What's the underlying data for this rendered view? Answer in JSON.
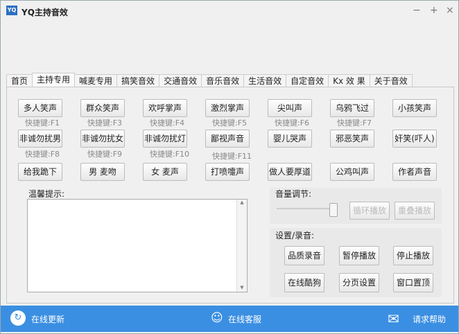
{
  "window": {
    "title": "YQ主持音效",
    "logo": "YQ",
    "minimize": "−",
    "maximize": "+",
    "close": "×"
  },
  "tabs": [
    "首页",
    "主持专用",
    "喊麦专用",
    "搞笑音效",
    "交通音效",
    "音乐音效",
    "生活音效",
    "自定音效",
    "Kx 效 果",
    "关于音效"
  ],
  "active_tab": 1,
  "buttons": [
    [
      "多人笑声",
      "群众笑声",
      "欢呼掌声",
      "激烈掌声",
      "尖叫声",
      "乌鸦飞过",
      "小孩笑声"
    ],
    [
      "非诚勿扰男",
      "非诚勿扰女",
      "非诚勿扰灯",
      "鄙视声音",
      "婴儿哭声",
      "邪恶笑声",
      "奸笑(吓人)"
    ],
    [
      "给我跪下",
      "男 麦吻",
      "女 麦声",
      "打喷嚏声",
      "做人要厚道",
      "公鸡叫声",
      "作者声音"
    ]
  ],
  "shortcuts": [
    [
      "快捷键:F1",
      "快捷键:F3",
      "快捷键:F4",
      "快捷键:F5",
      "快捷键:F6",
      "快捷键:F7"
    ],
    [
      "快捷键:F8",
      "快捷键:F9",
      "快捷键:F10",
      "快捷键:F11"
    ]
  ],
  "tips": {
    "label": "温馨提示:",
    "value": ""
  },
  "volume": {
    "label": "音量调节:",
    "level": 1.0,
    "loop": "循环播放",
    "repeat": "重叠播放"
  },
  "settings": {
    "label": "设置/录音:",
    "buttons": [
      "品质录音",
      "暂停播放",
      "停止播放",
      "在线酷狗",
      "分页设置",
      "窗口置顶"
    ]
  },
  "footer": {
    "update": "在线更新",
    "service": "在线客服",
    "help": "请求帮助"
  },
  "colors": {
    "footer": "#3b8fe2"
  }
}
